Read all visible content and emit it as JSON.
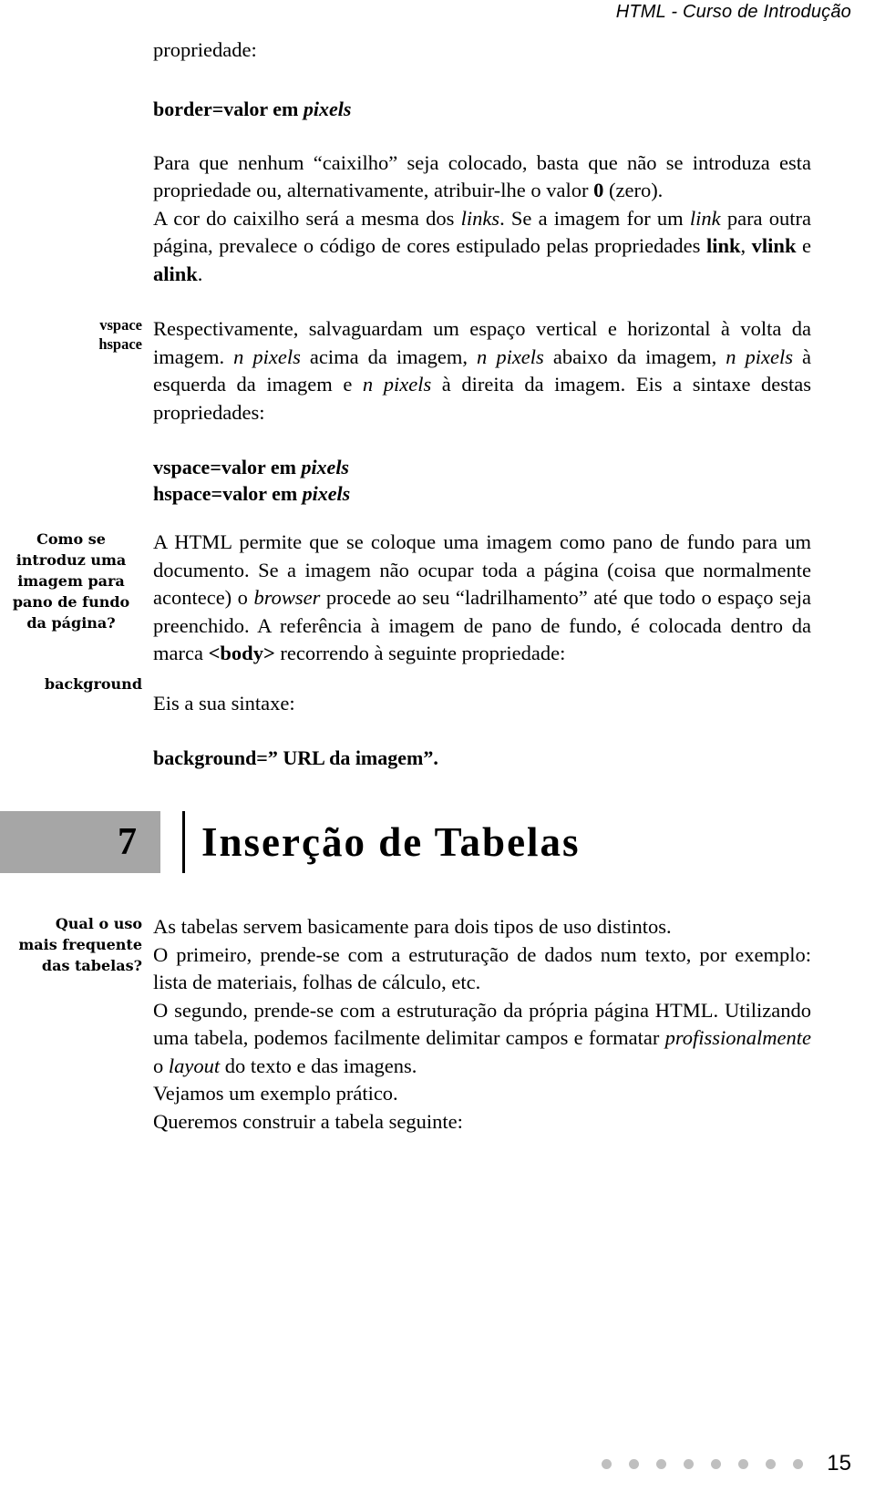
{
  "header": {
    "title": "HTML - Curso de Introdução"
  },
  "sections": {
    "border": {
      "lead_label": "propriedade:",
      "syntax_prefix": "border=valor em ",
      "syntax_italic": "pixels",
      "paragraph": {
        "p1_a": "Para que nenhum “caixilho” seja colocado, basta que não se introduza esta propriedade ou, alternativamente, atribuir-lhe o valor ",
        "p1_bold": "0",
        "p1_b": " (zero).",
        "p2_a": "A cor do caixilho será a mesma dos ",
        "p2_it1": "links",
        "p2_b": ". Se a imagem for um ",
        "p2_it2": "link",
        "p2_c": " para outra página, prevalece o código de cores estipulado pelas propriedades ",
        "p2_bold1": "link",
        "p2_d": ", ",
        "p2_bold2": "vlink",
        "p2_e": " e ",
        "p2_bold3": "alink",
        "p2_f": "."
      }
    },
    "vspace_hspace": {
      "note_line1": "vspace",
      "note_line2": "hspace",
      "paragraph": {
        "a": "Respectivamente, salvaguardam um espaço vertical e horizontal à volta da imagem. ",
        "it1": "n pixels",
        "b": " acima da imagem, ",
        "it2": "n pixels",
        "c": " abaixo da imagem, ",
        "it3": "n pixels",
        "d": " à esquerda da imagem e ",
        "it4": "n pixels",
        "e": " à direita da imagem. Eis a sintaxe destas propriedades:"
      },
      "syntax1_prefix": "vspace=valor em ",
      "syntax1_italic": "pixels",
      "syntax2_prefix": "hspace=valor em ",
      "syntax2_italic": "pixels"
    },
    "background": {
      "note_line1": "Como se",
      "note_line2": "introduz uma",
      "note_line3": "imagem para",
      "note_line4": "pano de fundo",
      "note_line5": "da página?",
      "note_property": "background",
      "paragraph": {
        "a": "A HTML permite que se coloque uma imagem como pano de fundo para um documento. Se a imagem não ocupar toda a página (coisa que normalmente acontece) o ",
        "it1": "browser",
        "b": " procede ao seu “ladrilhamento” até que todo o espaço seja preenchido. A referência à imagem de pano de fundo, é colocada dentro da marca ",
        "bold1": "<body>",
        "c": " recorrendo à seguinte propriedade:"
      },
      "syntax_lead": "Eis a sua sintaxe:",
      "syntax": "background=” URL da imagem”."
    },
    "chapter": {
      "number": "7",
      "title": "Inserção de Tabelas"
    },
    "tables": {
      "note_line1": "Qual o uso",
      "note_line2": "mais frequente",
      "note_line3": "das tabelas?",
      "paragraph": {
        "l1": "As tabelas servem basicamente para dois tipos de uso distintos.",
        "l2": "O primeiro, prende-se com a estruturação de dados num texto, por exemplo: lista de materiais, folhas de cálculo, etc.",
        "l3_a": "O segundo, prende-se com a estruturação da própria página HTML. Utilizando uma tabela, podemos facilmente delimitar campos e formatar ",
        "l3_it1": "profissionalmente",
        "l3_b": " o ",
        "l3_it2": "layout",
        "l3_c": " do texto e das imagens.",
        "l4": "Vejamos um exemplo prático.",
        "l5": "Queremos construir a tabela seguinte:"
      }
    }
  },
  "footer": {
    "page_number": "15",
    "dot_count": 8,
    "dot_color": "#bfbfbf"
  }
}
